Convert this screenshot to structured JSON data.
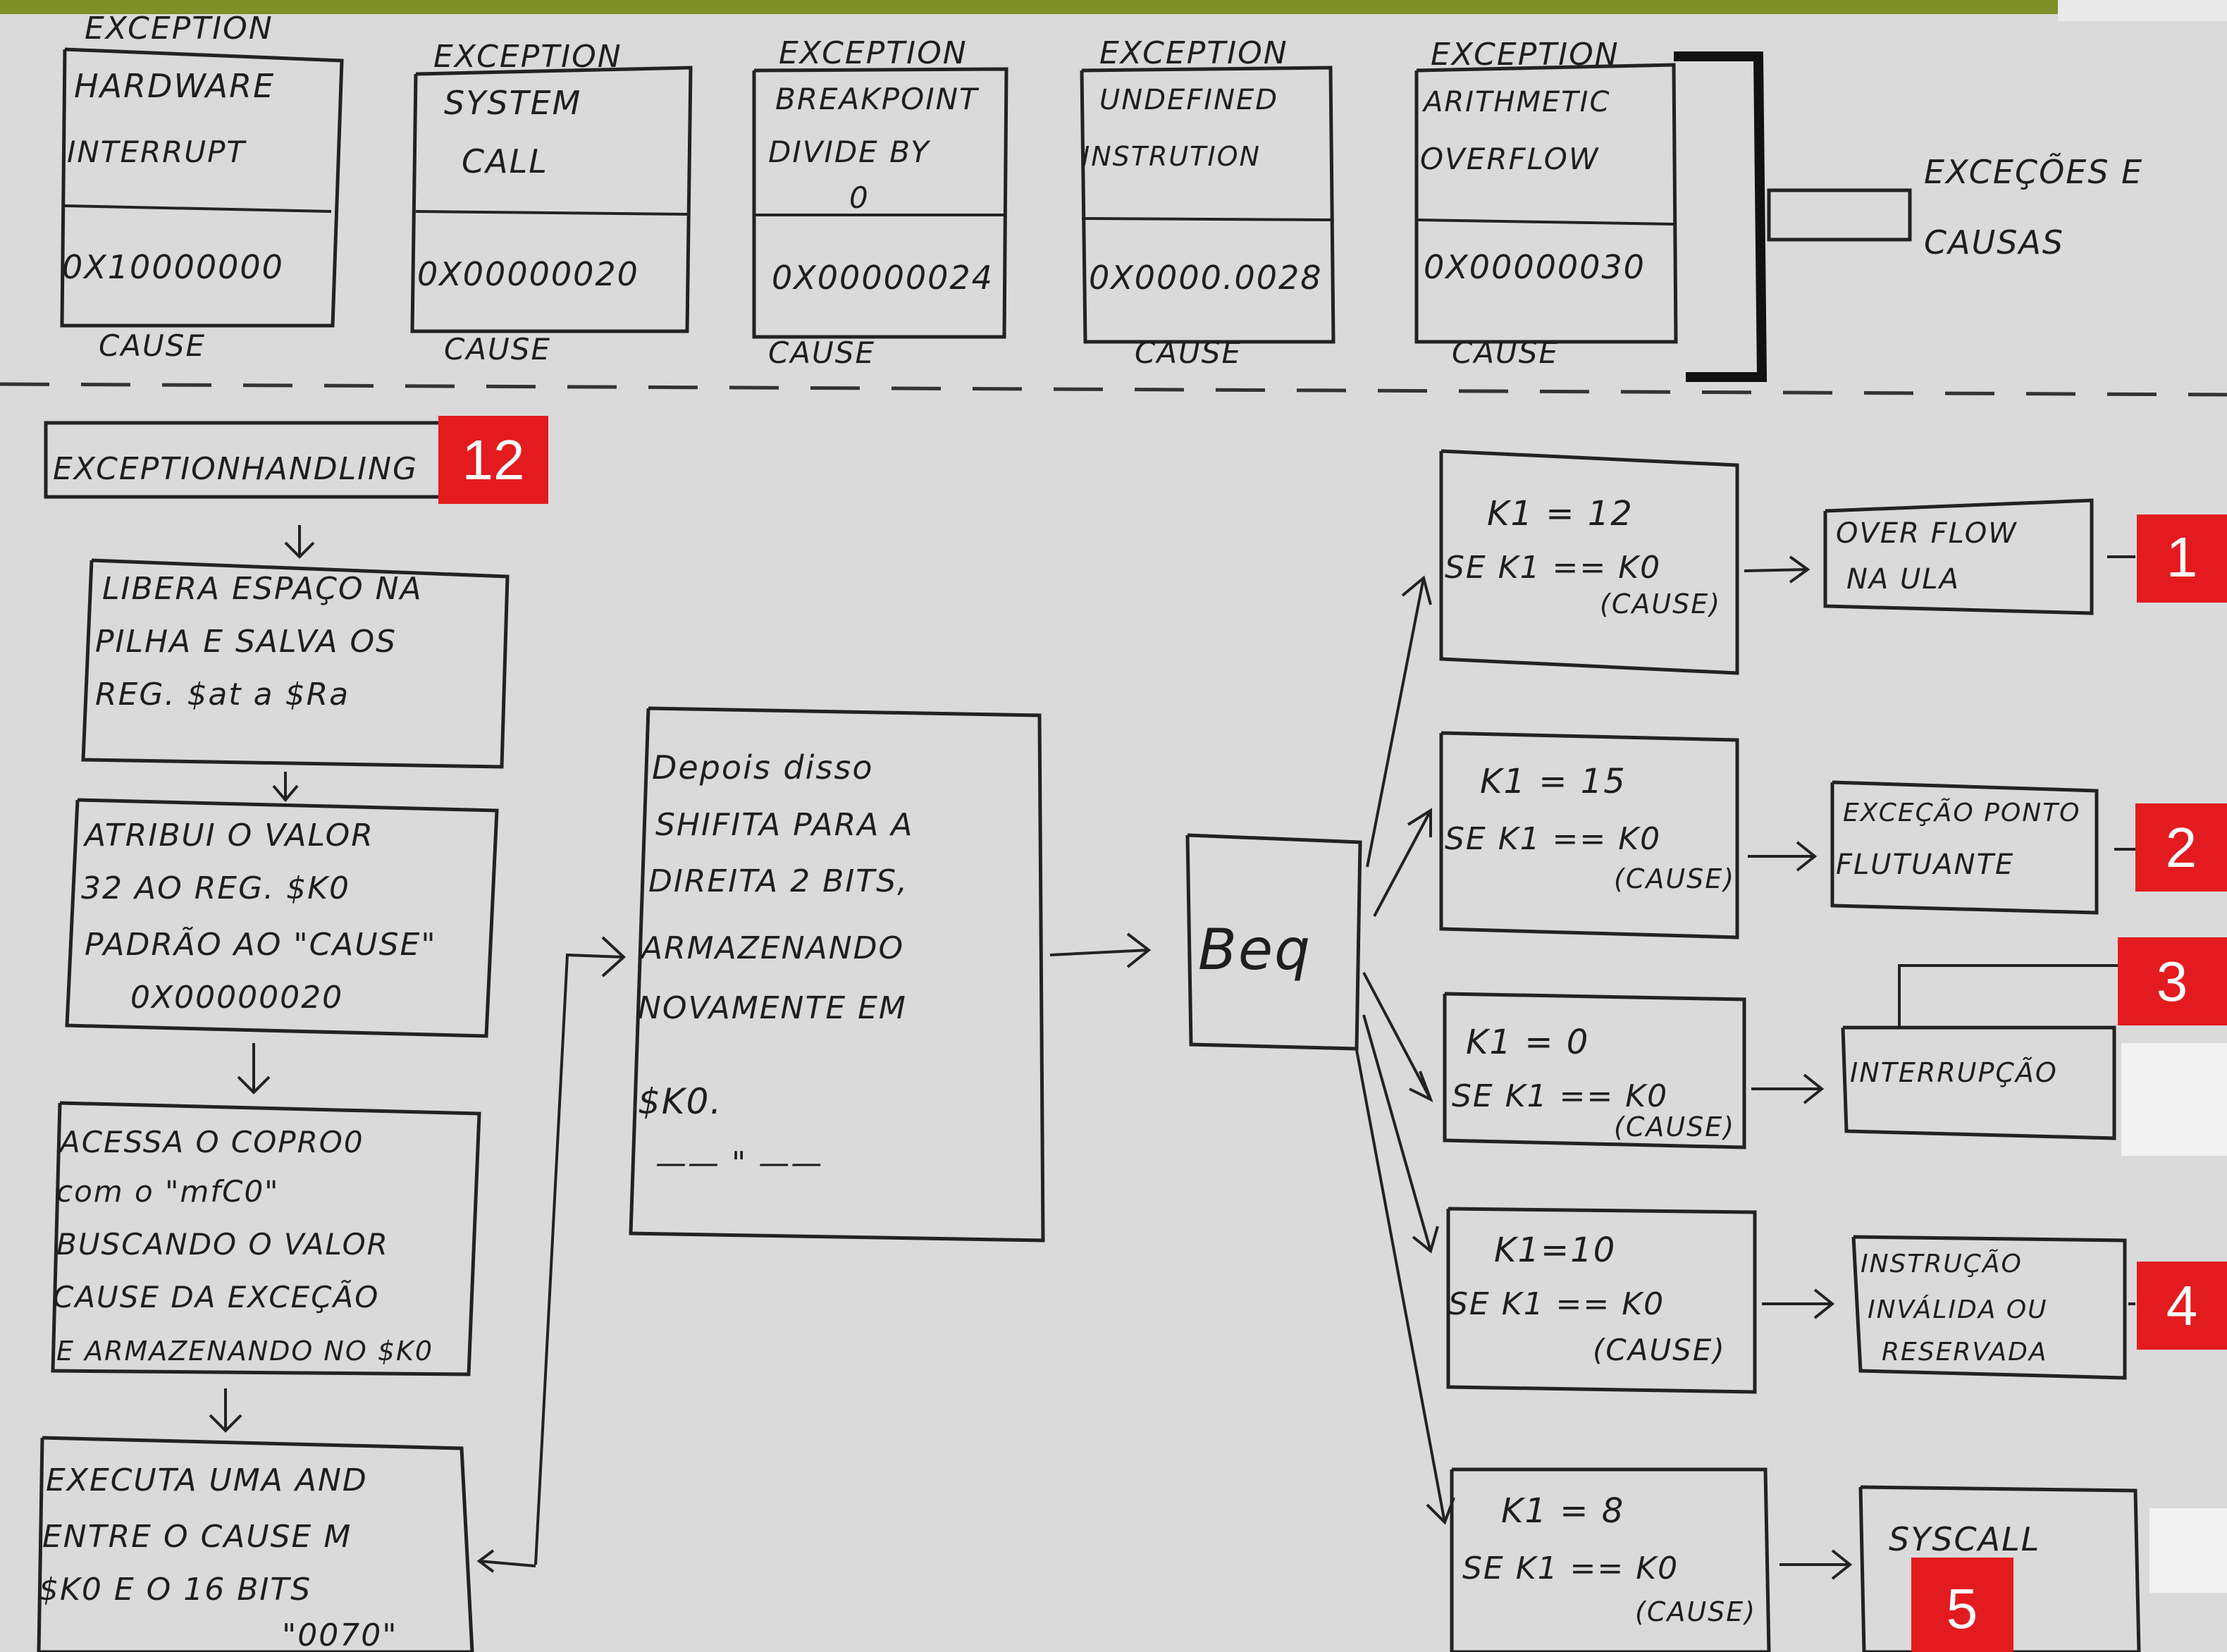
{
  "top_exceptions": [
    {
      "header": "EXCEPTION",
      "lines": [
        "HARDWARE",
        "INTERRUPT"
      ],
      "code": "0X10000000",
      "footer": "CAUSE"
    },
    {
      "header": "EXCEPTION",
      "lines": [
        "SYSTEM",
        "CALL"
      ],
      "code": "0X00000020",
      "footer": "CAUSE"
    },
    {
      "header": "EXCEPTION",
      "lines": [
        "BREAKPOINT",
        "DIVIDE BY",
        "0"
      ],
      "code": "0X00000024",
      "footer": "CAUSE"
    },
    {
      "header": "EXCEPTION",
      "lines": [
        "UNDEFINED",
        "INSTRUTION"
      ],
      "code": "0X0000.0028",
      "footer": "CAUSE"
    },
    {
      "header": "EXCEPTION",
      "lines": [
        "ARITHMETIC",
        "OVERFLOW"
      ],
      "code": "0X00000030",
      "footer": "CAUSE"
    }
  ],
  "summary_label": [
    "EXCEÇÕES E",
    "CAUSAS"
  ],
  "handling_title": "EXCEPTIONHANDLING",
  "steps": [
    [
      "LIBERA ESPAÇO NA",
      "PILHA E SALVA OS",
      "REG. $at a $Ra"
    ],
    [
      "ATRIBUI O VALOR",
      "32 AO REG. $K0",
      "PADRÃO AO \"CAUSE\"",
      "0X00000020"
    ],
    [
      "ACESSA O COPRO0",
      "com o \"mfC0\"",
      "BUSCANDO O VALOR",
      "CAUSE DA EXCEÇÃO",
      "E ARMAZENANDO NO $K0"
    ],
    [
      "EXECUTA UMA AND",
      "ENTRE O CAUSE M",
      "$K0 E O 16 BITS",
      "\"0070\""
    ]
  ],
  "middle_note": [
    "Depois disso",
    "SHIFITA PARA A",
    "DIREITA 2 BITS,",
    "ARMAZENANDO",
    "NOVAMENTE EM",
    "$K0.",
    "—— \" ——"
  ],
  "beq_label": "Beq",
  "branches": [
    {
      "k": "K1 = 12",
      "cond": "SE K1 == K0",
      "cause": "(CAUSE)",
      "result": [
        "OVER FLOW",
        "NA ULA"
      ]
    },
    {
      "k": "K1 = 15",
      "cond": "SE K1 == K0",
      "cause": "(CAUSE)",
      "result": [
        "EXCEÇÃO PONTO",
        "FLUTUANTE"
      ]
    },
    {
      "k": "K1 = 0",
      "cond": "SE K1 == K0",
      "cause": "(CAUSE)",
      "result": [
        "INTERRUPÇÃO"
      ]
    },
    {
      "k": "K1=10",
      "cond": "SE K1 == K0",
      "cause": "(CAUSE)",
      "result": [
        "INSTRUÇÃO",
        "INVÁLIDA OU",
        "RESERVADA"
      ]
    },
    {
      "k": "K1 = 8",
      "cond": "SE K1 == K0",
      "cause": "(CAUSE)",
      "result": [
        "SYSCALL"
      ]
    }
  ],
  "badges": {
    "handling": "12",
    "b1": "1",
    "b2": "2",
    "b3": "3",
    "b4": "4",
    "b5": "5"
  },
  "colors": {
    "badge": "#e31b1f",
    "paper": "#d9d9d9",
    "ink": "#1e1e1e"
  }
}
